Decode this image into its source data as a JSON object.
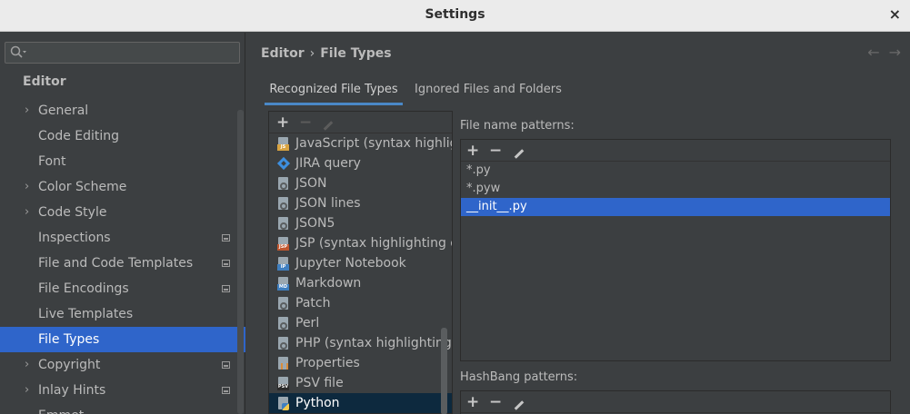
{
  "window": {
    "title": "Settings",
    "close_glyph": "×"
  },
  "sidebar": {
    "search_placeholder": "",
    "heading": "Editor",
    "items": [
      {
        "label": "General",
        "arrow": true,
        "project": false,
        "selected": false
      },
      {
        "label": "Code Editing",
        "arrow": false,
        "project": false,
        "selected": false
      },
      {
        "label": "Font",
        "arrow": false,
        "project": false,
        "selected": false
      },
      {
        "label": "Color Scheme",
        "arrow": true,
        "project": false,
        "selected": false
      },
      {
        "label": "Code Style",
        "arrow": true,
        "project": false,
        "selected": false
      },
      {
        "label": "Inspections",
        "arrow": false,
        "project": true,
        "selected": false
      },
      {
        "label": "File and Code Templates",
        "arrow": false,
        "project": true,
        "selected": false
      },
      {
        "label": "File Encodings",
        "arrow": false,
        "project": true,
        "selected": false
      },
      {
        "label": "Live Templates",
        "arrow": false,
        "project": false,
        "selected": false
      },
      {
        "label": "File Types",
        "arrow": false,
        "project": false,
        "selected": true
      },
      {
        "label": "Copyright",
        "arrow": true,
        "project": true,
        "selected": false
      },
      {
        "label": "Inlay Hints",
        "arrow": true,
        "project": true,
        "selected": false
      },
      {
        "label": "Emmet",
        "arrow": false,
        "project": false,
        "selected": false
      }
    ]
  },
  "main": {
    "breadcrumb": {
      "parent": "Editor",
      "separator": "›",
      "current": "File Types"
    },
    "nav": {
      "back": "←",
      "forward": "→"
    },
    "tabs": [
      {
        "label": "Recognized File Types",
        "active": true
      },
      {
        "label": "Ignored Files and Folders",
        "active": false
      }
    ],
    "file_types_toolbar": {
      "add": "+",
      "remove": "−"
    },
    "file_types": [
      {
        "label": "JavaScript (syntax highlight",
        "icon": "js-file-icon",
        "badge": "JS",
        "badge_color": "#d9a441"
      },
      {
        "label": "JIRA query",
        "icon": "jira-query-icon",
        "badge": "",
        "badge_color": "#3d8fe0"
      },
      {
        "label": "JSON",
        "icon": "json-file-icon",
        "badge": "",
        "badge_color": ""
      },
      {
        "label": "JSON lines",
        "icon": "json-lines-file-icon",
        "badge": "",
        "badge_color": ""
      },
      {
        "label": "JSON5",
        "icon": "json5-file-icon",
        "badge": "",
        "badge_color": ""
      },
      {
        "label": "JSP (syntax highlighting on",
        "icon": "jsp-file-icon",
        "badge": "JSP",
        "badge_color": "#c0562f"
      },
      {
        "label": "Jupyter Notebook",
        "icon": "jupyter-file-icon",
        "badge": "IP",
        "badge_color": "#3f7fc0"
      },
      {
        "label": "Markdown",
        "icon": "markdown-file-icon",
        "badge": "MD",
        "badge_color": "#3f7fc0"
      },
      {
        "label": "Patch",
        "icon": "patch-file-icon",
        "badge": "",
        "badge_color": ""
      },
      {
        "label": "Perl",
        "icon": "perl-file-icon",
        "badge": "",
        "badge_color": ""
      },
      {
        "label": "PHP (syntax highlighting or",
        "icon": "php-file-icon",
        "badge": "",
        "badge_color": ""
      },
      {
        "label": "Properties",
        "icon": "properties-file-icon",
        "badge": "",
        "badge_color": ""
      },
      {
        "label": "PSV file",
        "icon": "psv-file-icon",
        "badge": "PSV",
        "badge_color": "#2b2b2b"
      },
      {
        "label": "Python",
        "icon": "python-file-icon",
        "badge": "",
        "badge_color": ""
      }
    ],
    "selected_file_type": "Python",
    "patterns": {
      "label": "File name patterns:",
      "items": [
        "*.py",
        "*.pyw",
        "__init__.py"
      ],
      "selected": "__init__.py"
    },
    "hashbang": {
      "label": "HashBang patterns:"
    },
    "pattern_toolbar": {
      "add": "+",
      "remove": "−"
    }
  },
  "colors": {
    "accent": "#2f65ca",
    "selection_dark": "#0d293e",
    "background": "#3c3f41",
    "tab_underline": "#4a88c7"
  }
}
